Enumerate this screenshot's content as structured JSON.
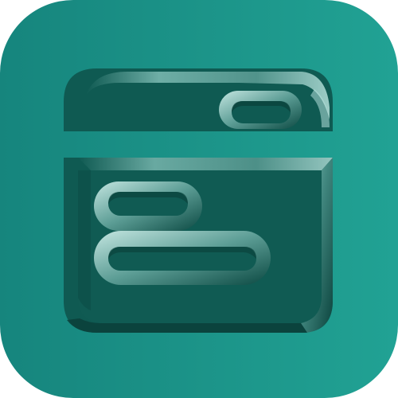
{
  "icon": {
    "name": "browser-window-app-icon",
    "colors": {
      "tile_start": "#16857d",
      "tile_end": "#21a294",
      "panel": "#0f5a52",
      "panel_light": "#1a6d64",
      "bevel_light": "#8fc9c2",
      "bevel_mid": "#4a8f87",
      "bevel_dark": "#0a3f39"
    }
  }
}
